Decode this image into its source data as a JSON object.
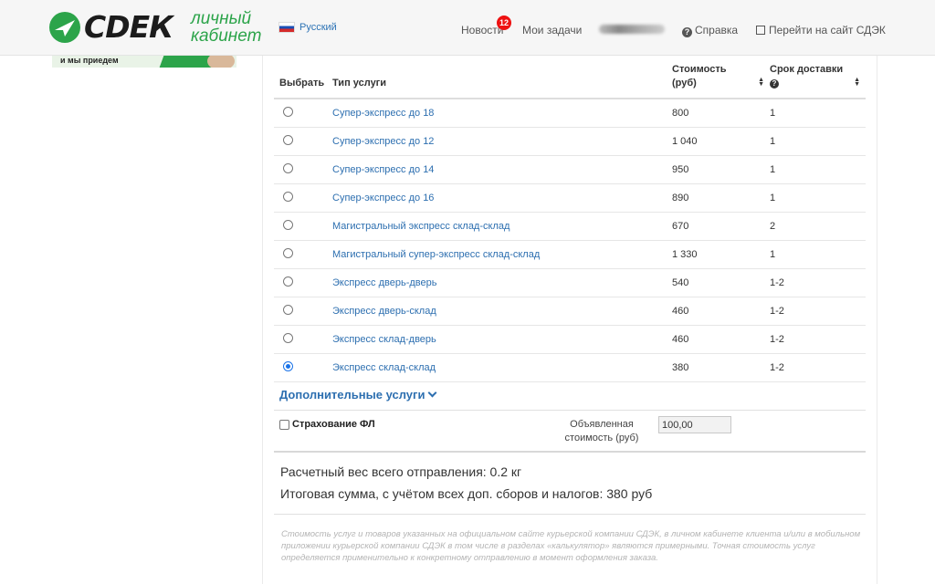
{
  "header": {
    "logo_word": "СDЕК",
    "logo_subtitle_line1": "личный",
    "logo_subtitle_line2": "кабинет",
    "language": "Русский",
    "nav": {
      "news": "Новости",
      "news_badge": "12",
      "tasks": "Мои задачи",
      "help": "Справка",
      "goto_site": "Перейти на сайт СДЭК"
    }
  },
  "banner": {
    "text": "и мы приедем"
  },
  "table": {
    "headers": {
      "select": "Выбрать",
      "type": "Тип услуги",
      "cost_line1": "Стоимость",
      "cost_line2": "(руб)",
      "term": "Срок доставки"
    },
    "rows": [
      {
        "name": "Супер-экспресс до 18",
        "cost": "800",
        "term": "1",
        "selected": false
      },
      {
        "name": "Супер-экспресс до 12",
        "cost": "1 040",
        "term": "1",
        "selected": false
      },
      {
        "name": "Супер-экспресс до 14",
        "cost": "950",
        "term": "1",
        "selected": false
      },
      {
        "name": "Супер-экспресс до 16",
        "cost": "890",
        "term": "1",
        "selected": false
      },
      {
        "name": "Магистральный экспресс склад-склад",
        "cost": "670",
        "term": "2",
        "selected": false
      },
      {
        "name": "Магистральный супер-экспресс склад-склад",
        "cost": "1 330",
        "term": "1",
        "selected": false
      },
      {
        "name": "Экспресс дверь-дверь",
        "cost": "540",
        "term": "1-2",
        "selected": false
      },
      {
        "name": "Экспресс дверь-склад",
        "cost": "460",
        "term": "1-2",
        "selected": false
      },
      {
        "name": "Экспресс склад-дверь",
        "cost": "460",
        "term": "1-2",
        "selected": false
      },
      {
        "name": "Экспресс склад-склад",
        "cost": "380",
        "term": "1-2",
        "selected": true
      }
    ]
  },
  "extra": {
    "title": "Дополнительные услуги",
    "insurance_label": "Страхование ФЛ",
    "declared_line1": "Объявленная",
    "declared_line2": "стоимость (руб)",
    "declared_value": "100,00"
  },
  "summary": {
    "weight": "Расчетный вес всего отправления: 0.2 кг",
    "total": "Итоговая сумма, с учётом всех доп. сборов и налогов: 380 руб"
  },
  "disclaimer": "Стоимость услуг и товаров указанных на официальном сайте курьерской компании СДЭК, в личном кабинете клиента и/или в мобильном приложении курьерской компании СДЭК в том числе в разделах «калькулятор» являются примерными. Точная стоимость услуг определяется применительно к конкретному отправлению в момент оформления заказа.",
  "colors": {
    "brand_green": "#2ca44a",
    "link_blue": "#2d6fb0",
    "badge_red": "#e11111"
  }
}
